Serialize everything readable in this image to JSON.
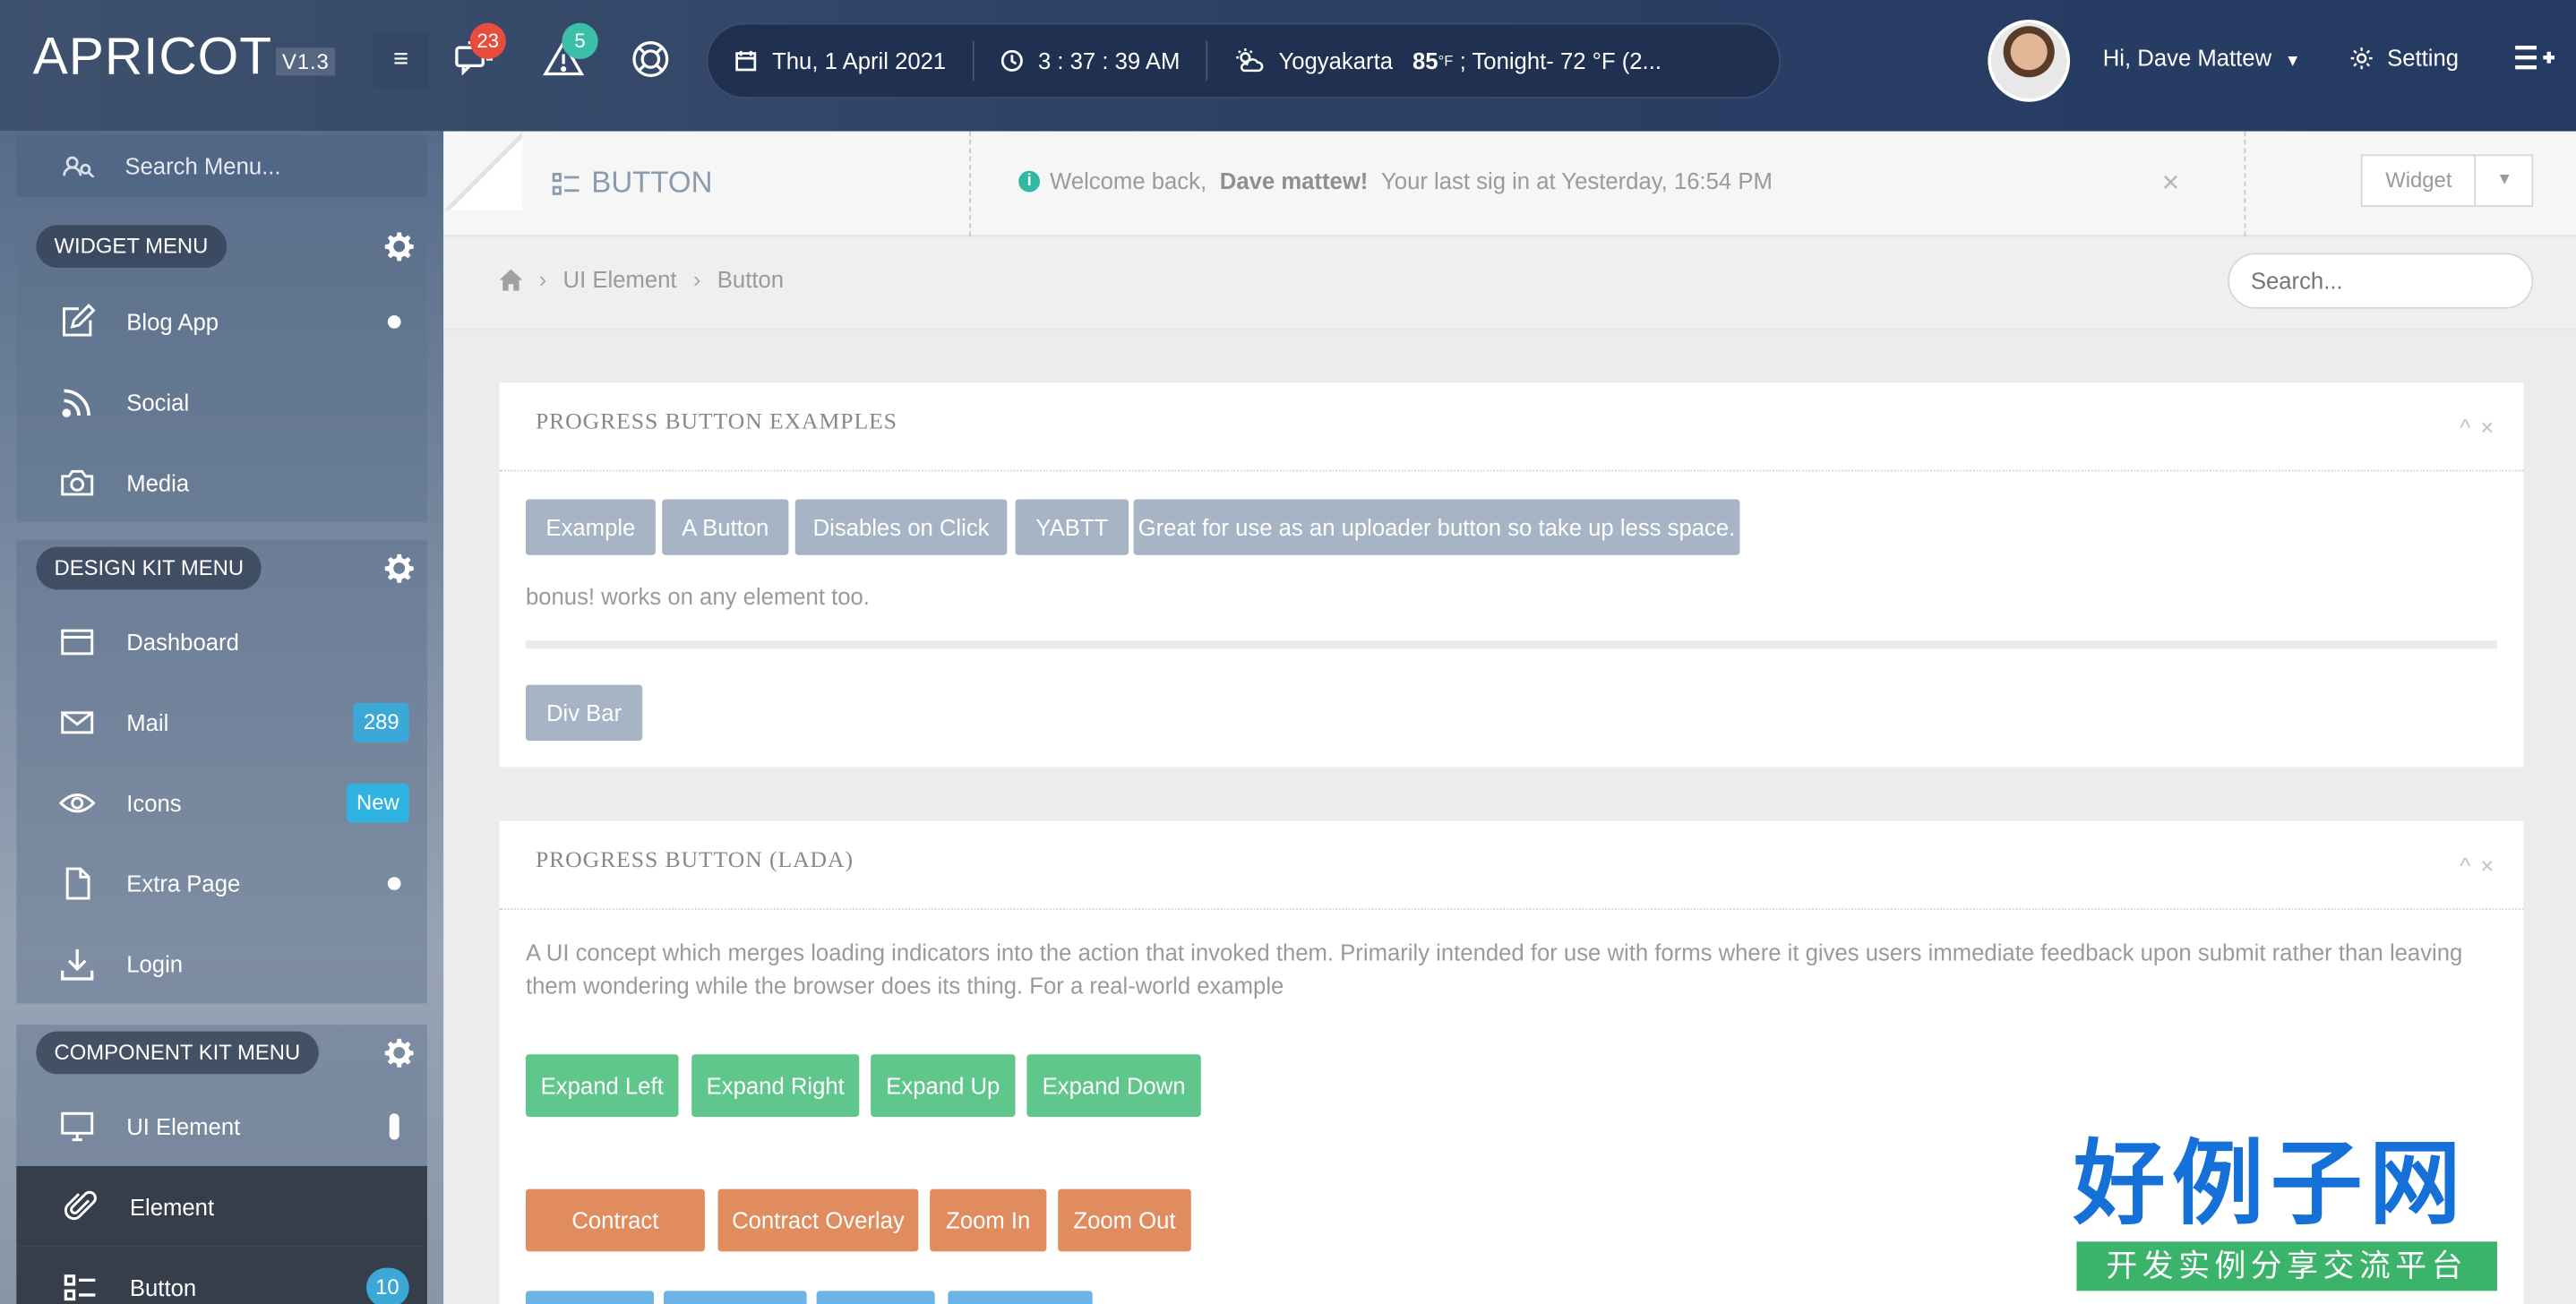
{
  "header": {
    "brand": "APRICOT",
    "version": "V1.3",
    "menu_toggle": "≡",
    "messages_badge": "23",
    "alerts_badge": "5",
    "date": "Thu, 1 April 2021",
    "time": "3 : 37 : 39 AM",
    "weather_city": "Yogyakarta",
    "weather_temp": "85",
    "weather_unit": "°F",
    "weather_tonight": "; Tonight- 72 °F (2...",
    "greeting": "Hi, Dave Mattew",
    "setting_label": "Setting"
  },
  "sidebar": {
    "search_placeholder": "Search Menu...",
    "widget_menu": {
      "title": "WIDGET MENU",
      "items": [
        {
          "label": "Blog App",
          "icon": "edit-icon"
        },
        {
          "label": "Social",
          "icon": "rss-icon"
        },
        {
          "label": "Media",
          "icon": "camera-icon"
        }
      ]
    },
    "design_menu": {
      "title": "DESIGN KIT MENU",
      "items": [
        {
          "label": "Dashboard",
          "icon": "browser-icon"
        },
        {
          "label": "Mail",
          "icon": "mail-icon",
          "badge": "289"
        },
        {
          "label": "Icons",
          "icon": "eye-icon",
          "badge": "New"
        },
        {
          "label": "Extra Page",
          "icon": "file-icon"
        },
        {
          "label": "Login",
          "icon": "download-icon"
        }
      ]
    },
    "component_menu": {
      "title": "COMPONENT KIT MENU",
      "items": [
        {
          "label": "UI Element",
          "icon": "monitor-icon"
        },
        {
          "label": "Element",
          "icon": "paperclip-icon"
        },
        {
          "label": "Button",
          "icon": "list-icon",
          "badge": "10"
        }
      ]
    }
  },
  "page": {
    "title": "BUTTON",
    "welcome_prefix": "Welcome back,",
    "welcome_name": "Dave mattew!",
    "welcome_suffix": "Your last sig in at Yesterday, 16:54 PM",
    "widget_label": "Widget",
    "breadcrumb": [
      "UI Element",
      "Button"
    ],
    "search_placeholder": "Search..."
  },
  "card1": {
    "title": "PROGRESS BUTTON EXAMPLES",
    "buttons": [
      "Example",
      "A Button",
      "Disables on Click",
      "YABTT",
      "Great for use as an uploader button so take up less space."
    ],
    "bonus_text": "bonus! works on any element too.",
    "div_bar_label": "Div Bar"
  },
  "card2": {
    "title": "PROGRESS BUTTON (LADA)",
    "description": "A UI concept which merges loading indicators into the action that invoked them. Primarily intended for use with forms where it gives users immediate feedback upon submit rather than leaving them wondering while the browser does its thing. For a real-world example",
    "expand_buttons": [
      "Expand Left",
      "Expand Right",
      "Expand Up",
      "Expand Down"
    ],
    "contract_buttons": [
      "Contract",
      "Contract Overlay",
      "Zoom In",
      "Zoom Out"
    ]
  },
  "watermark": {
    "main": "好例子网",
    "sub": "开发实例分享交流平台"
  },
  "colors": {
    "header_bg": "#2d4165",
    "gray_button": "#a6b4c5",
    "green_button": "#5fc78b",
    "orange_button": "#e08c5e",
    "badge_red": "#e74c3c",
    "badge_teal": "#3bbfa8",
    "badge_blue": "#3ba8d8"
  }
}
